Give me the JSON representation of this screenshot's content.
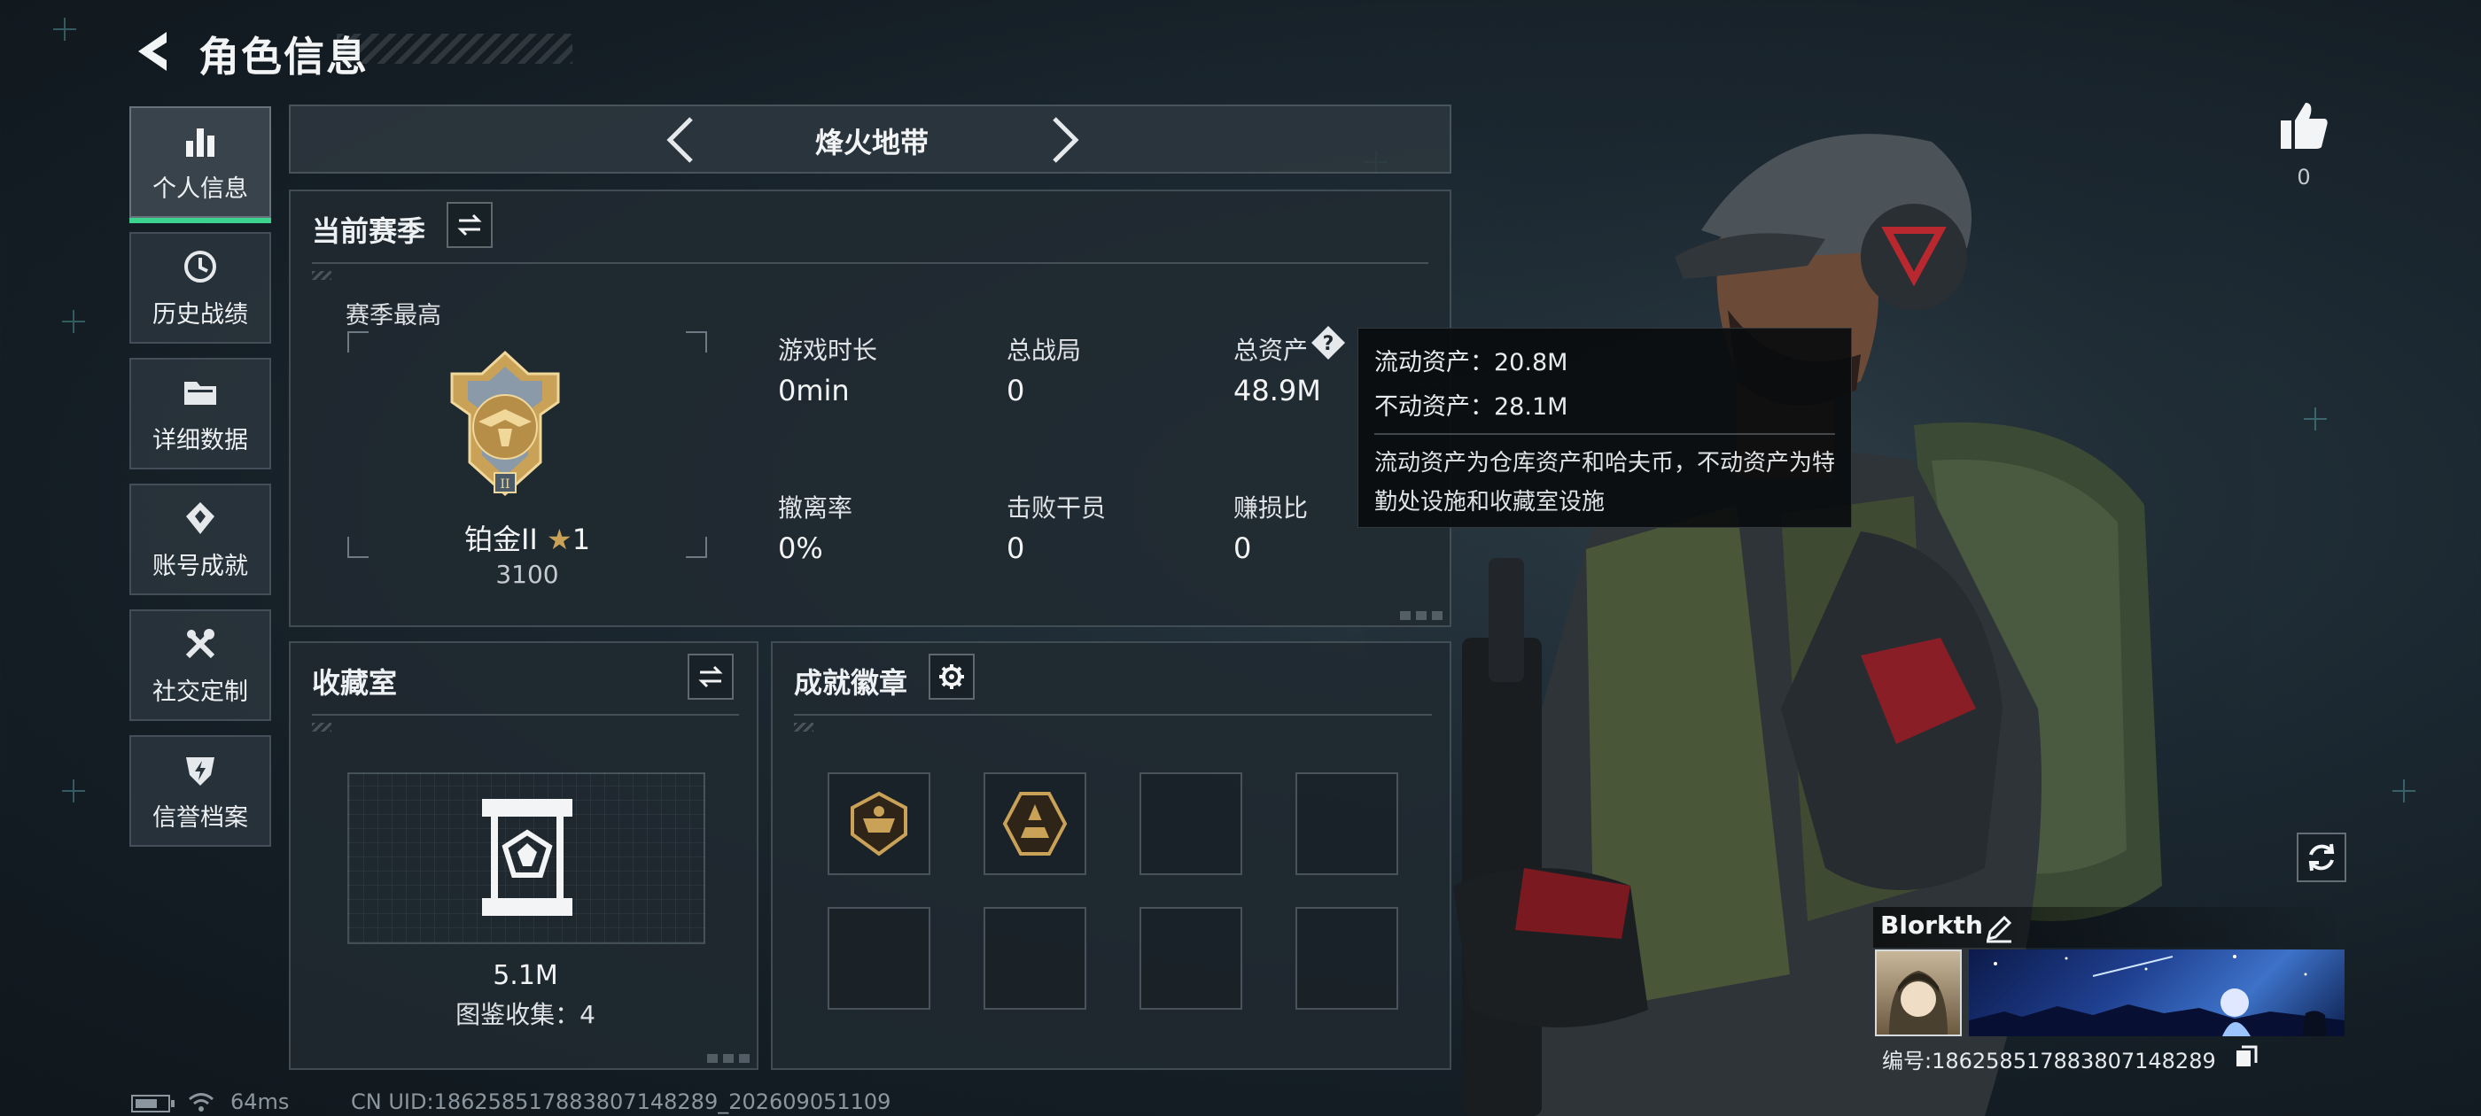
{
  "header": {
    "title": "角色信息"
  },
  "sidebar": {
    "items": [
      {
        "label": "个人信息",
        "icon": "bar-chart-icon",
        "active": true
      },
      {
        "label": "历史战绩",
        "icon": "history-clock-icon",
        "active": false
      },
      {
        "label": "详细数据",
        "icon": "folder-icon",
        "active": false
      },
      {
        "label": "账号成就",
        "icon": "achievement-icon",
        "active": false
      },
      {
        "label": "社交定制",
        "icon": "tools-icon",
        "active": false
      },
      {
        "label": "信誉档案",
        "icon": "shield-bolt-icon",
        "active": false
      }
    ]
  },
  "mode": {
    "name": "烽火地带"
  },
  "season": {
    "title": "当前赛季",
    "best_label": "赛季最高",
    "rank_name": "铂金II",
    "rank_stars": "1",
    "rank_score": "3100",
    "stats": [
      {
        "label": "游戏时长",
        "value": "0min"
      },
      {
        "label": "总战局",
        "value": "0"
      },
      {
        "label": "总资产",
        "value": "48.9M"
      },
      {
        "label": "撤离率",
        "value": "0%"
      },
      {
        "label": "击败干员",
        "value": "0"
      },
      {
        "label": "赚损比",
        "value": "0"
      }
    ]
  },
  "tooltip": {
    "liquid": "流动资产：20.8M",
    "fixed": "不动资产：28.1M",
    "description": "流动资产为仓库资产和哈夫币，不动资产为特勤处设施和收藏室设施"
  },
  "collection": {
    "title": "收藏室",
    "value": "5.1M",
    "count_text": "图鉴收集：4"
  },
  "achievements": {
    "title": "成就徽章",
    "slots": [
      {
        "filled": true
      },
      {
        "filled": true
      },
      {
        "filled": false
      },
      {
        "filled": false
      },
      {
        "filled": false
      },
      {
        "filled": false
      },
      {
        "filled": false
      },
      {
        "filled": false
      }
    ]
  },
  "likes": {
    "count": "0"
  },
  "profile": {
    "name": "Blorkth",
    "id_text": "编号:186258517883807148289"
  },
  "status_bar": {
    "ping": "64ms",
    "uid": "CN UID:186258517883807148289_202609051109"
  },
  "colors": {
    "accent": "#3bd38e",
    "tooltip_bg": "#0a0c0e",
    "panel_bg": "#212a31",
    "gold": "#c9a258"
  }
}
